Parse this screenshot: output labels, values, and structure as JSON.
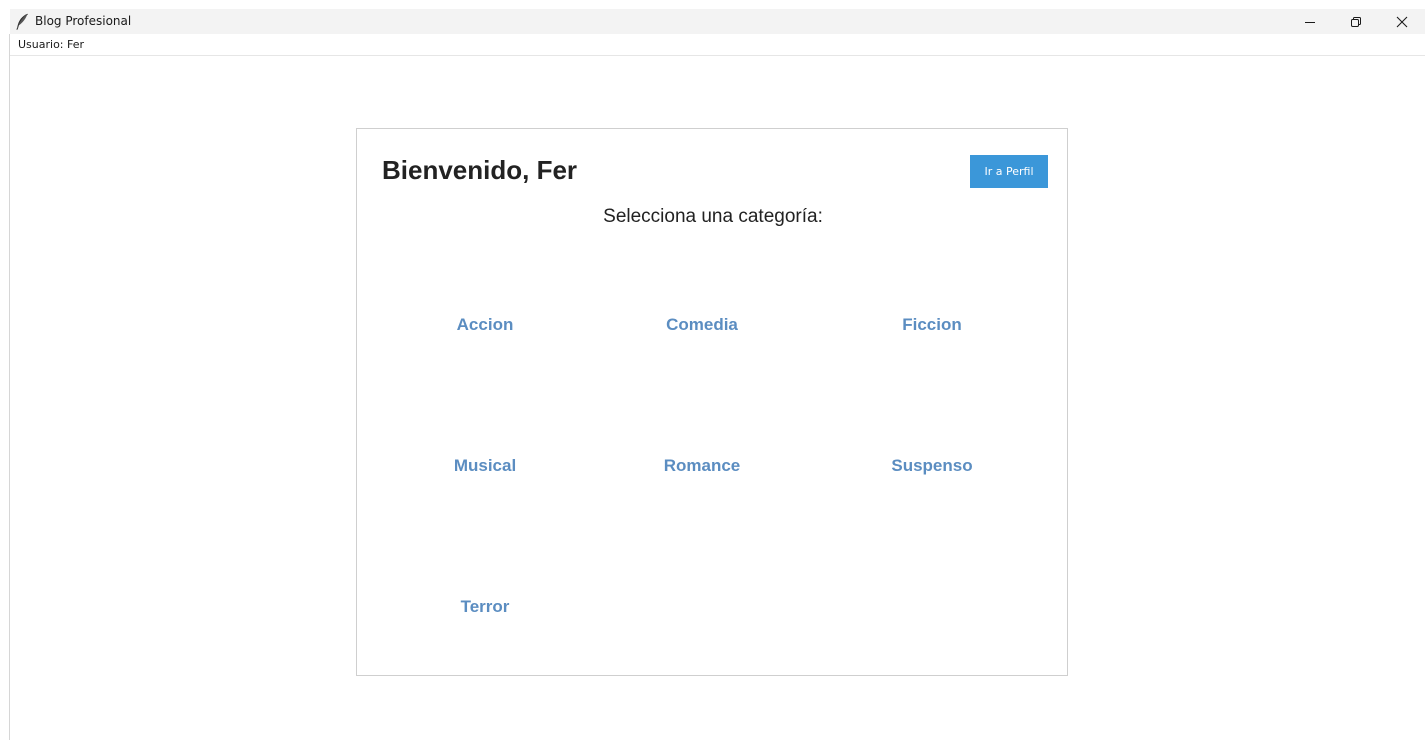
{
  "window": {
    "title": "Blog Profesional",
    "icon": "feather-icon",
    "controls": [
      "minimize-icon",
      "restore-icon",
      "close-icon"
    ]
  },
  "user_strip": {
    "label": "Usuario: Fer"
  },
  "main": {
    "welcome": "Bienvenido, Fer",
    "profile_button": "Ir a Perfil",
    "subtitle": "Selecciona una categoría:",
    "categories": [
      "Accion",
      "Comedia",
      "Ficcion",
      "Musical",
      "Romance",
      "Suspenso",
      "Terror"
    ]
  },
  "colors": {
    "accent_button": "#3b97d9",
    "category_link": "#5b8dc1",
    "titlebar_bg": "#f3f3f3",
    "card_border": "#cfcfcf"
  }
}
